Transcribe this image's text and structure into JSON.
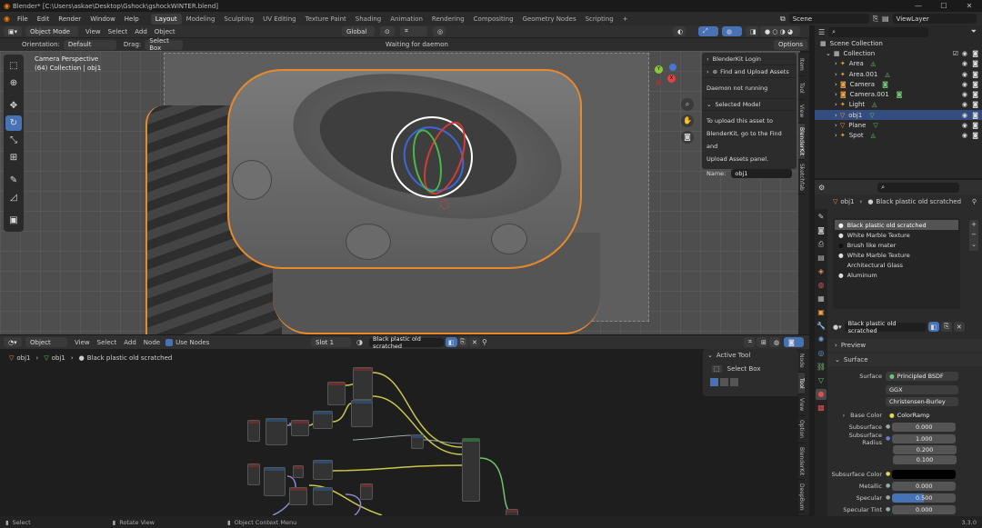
{
  "window": {
    "title": "Blender* [C:\\Users\\askae\\Desktop\\Gshock\\gshockWINTER.blend]"
  },
  "menu": {
    "items": [
      "File",
      "Edit",
      "Render",
      "Window",
      "Help"
    ],
    "workspaces": [
      "Layout",
      "Modeling",
      "Sculpting",
      "UV Editing",
      "Texture Paint",
      "Shading",
      "Animation",
      "Rendering",
      "Compositing",
      "Geometry Nodes",
      "Scripting"
    ],
    "active_workspace": "Layout",
    "scene": "Scene",
    "view_layer": "ViewLayer"
  },
  "viewport": {
    "mode": "Object Mode",
    "menus": [
      "View",
      "Select",
      "Add",
      "Object"
    ],
    "transform": "Global",
    "orientation_label": "Orientation:",
    "orientation": "Default",
    "drag_label": "Drag:",
    "drag": "Select Box",
    "options": "Options",
    "status": "Waiting for daemon",
    "overlay_title": "Camera Perspective",
    "overlay_sub": "(64) Collection | obj1",
    "tabs": [
      "Item",
      "Tool",
      "View",
      "BlenderKit",
      "Sketchfab"
    ],
    "active_tab": "BlenderKit"
  },
  "blenderkit": {
    "login": "BlenderKit Login",
    "find_upload": "Find and Upload Assets",
    "daemon": "Daemon not running",
    "selected_model": "Selected Model",
    "upload_text_1": "To upload this asset to",
    "upload_text_2": "BlenderKit, go to the Find and",
    "upload_text_3": "Upload Assets panel.",
    "name_label": "Name:",
    "name_value": "obj1"
  },
  "outliner": {
    "root": "Scene Collection",
    "collection": "Collection",
    "items": [
      "Area",
      "Area.001",
      "Camera",
      "Camera.001",
      "Light",
      "obj1",
      "Plane",
      "Spot"
    ],
    "selected": "obj1"
  },
  "properties": {
    "object": "obj1",
    "material": "Black plastic old scratched",
    "materials": [
      "Black plastic old scratched",
      "White Marble Texture",
      "Brush like mater",
      "White Marble Texture",
      "Architectural Glass",
      "Aluminum"
    ],
    "preview": "Preview",
    "surface_header": "Surface",
    "surface_label": "Surface",
    "surface_value": "Principled BSDF",
    "distribution": "GGX",
    "subsurface_method": "Christensen-Burley",
    "base_color_label": "Base Color",
    "base_color_value": "ColorRamp",
    "subsurface_label": "Subsurface",
    "subsurface_value": "0.000",
    "subsurface_radius_label": "Subsurface Radius",
    "subsurface_radius": [
      "1.000",
      "0.200",
      "0.100"
    ],
    "subsurface_color_label": "Subsurface Color",
    "metallic_label": "Metallic",
    "metallic_value": "0.000",
    "specular_label": "Specular",
    "specular_value": "0.500",
    "specular_tint_label": "Specular Tint",
    "specular_tint_value": "0.000"
  },
  "node_editor": {
    "type_menu": "Object",
    "menus": [
      "View",
      "Select",
      "Add",
      "Node"
    ],
    "use_nodes": "Use Nodes",
    "slot": "Slot 1",
    "material": "Black plastic old scratched",
    "breadcrumb": [
      "obj1",
      "obj1",
      "Black plastic old scratched"
    ],
    "active_tool_header": "Active Tool",
    "active_tool": "Select Box",
    "tabs": [
      "Node",
      "Tool",
      "View",
      "Option",
      "BlenderKit",
      "DeepBum"
    ]
  },
  "statusbar": {
    "select": "Select",
    "rotate": "Rotate View",
    "context": "Object Context Menu",
    "version": "3.3.0"
  },
  "colors": {
    "accent": "#4772b3",
    "selection_orange": "#e8892c",
    "active_tab": "#3d3d3d"
  }
}
